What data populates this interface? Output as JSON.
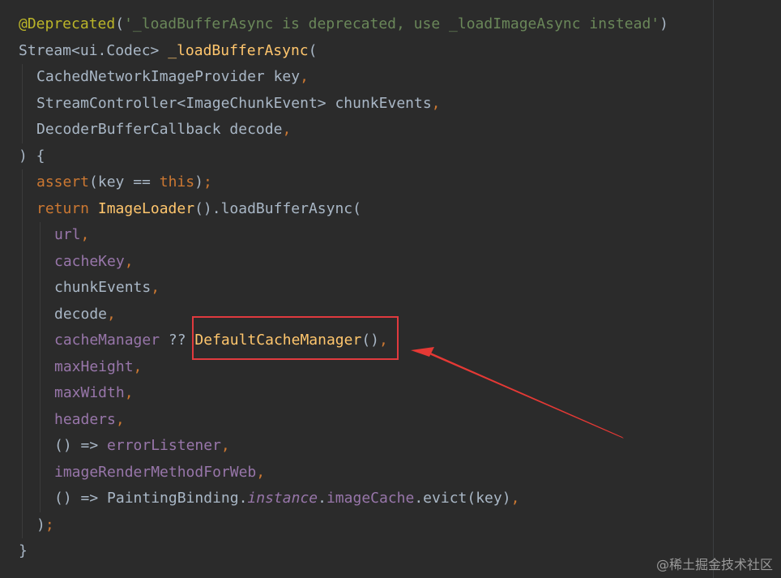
{
  "editor": {
    "theme": "darcula",
    "colors": {
      "background": "#2b2b2b",
      "annotation": "#bbb529",
      "string": "#6a8759",
      "keyword": "#cc7832",
      "function": "#ffc66d",
      "parameter": "#9876aa",
      "text": "#a9b7c6",
      "highlight_box": "#e03a3e"
    }
  },
  "code": {
    "l1": {
      "anno": "@Deprecated",
      "open": "(",
      "str": "'_loadBufferAsync is deprecated, use _loadImageAsync instead'",
      "close": ")"
    },
    "l2": {
      "type": "Stream<ui.Codec> ",
      "fn": "_loadBufferAsync",
      "open": "("
    },
    "l3": {
      "text": "CachedNetworkImageProvider key",
      "comma": ","
    },
    "l4": {
      "text": "StreamController<ImageChunkEvent> chunkEvents",
      "comma": ","
    },
    "l5": {
      "text": "DecoderBufferCallback decode",
      "comma": ","
    },
    "l6": {
      "text": ") {"
    },
    "l7": {
      "fn": "assert",
      "a": "(key == ",
      "kw": "this",
      "b": ")",
      "semi": ";"
    },
    "l8": {
      "kw": "return ",
      "fn": "ImageLoader",
      "rest": "().loadBufferAsync("
    },
    "l9": {
      "prm": "url",
      "comma": ","
    },
    "l10": {
      "prm": "cacheKey",
      "comma": ","
    },
    "l11": {
      "text": "chunkEvents",
      "comma": ","
    },
    "l12": {
      "text": "decode",
      "comma": ","
    },
    "l13": {
      "prm": "cacheManager",
      "op": " ?? ",
      "fn": "DefaultCacheManager",
      "paren": "()",
      "comma": ","
    },
    "l14": {
      "prm": "maxHeight",
      "comma": ","
    },
    "l15": {
      "prm": "maxWidth",
      "comma": ","
    },
    "l16": {
      "prm": "headers",
      "comma": ","
    },
    "l17": {
      "arrow": "() => ",
      "prm": "errorListener",
      "comma": ","
    },
    "l18": {
      "prm": "imageRenderMethodForWeb",
      "comma": ","
    },
    "l19": {
      "arrow": "() => PaintingBinding.",
      "ital": "instance",
      "dot": ".",
      "prm": "imageCache",
      "rest": ".evict(key)",
      "comma": ","
    },
    "l20": {
      "close": ")",
      "semi": ";"
    },
    "l21": {
      "text": "}"
    }
  },
  "watermark": "@稀土掘金技术社区"
}
